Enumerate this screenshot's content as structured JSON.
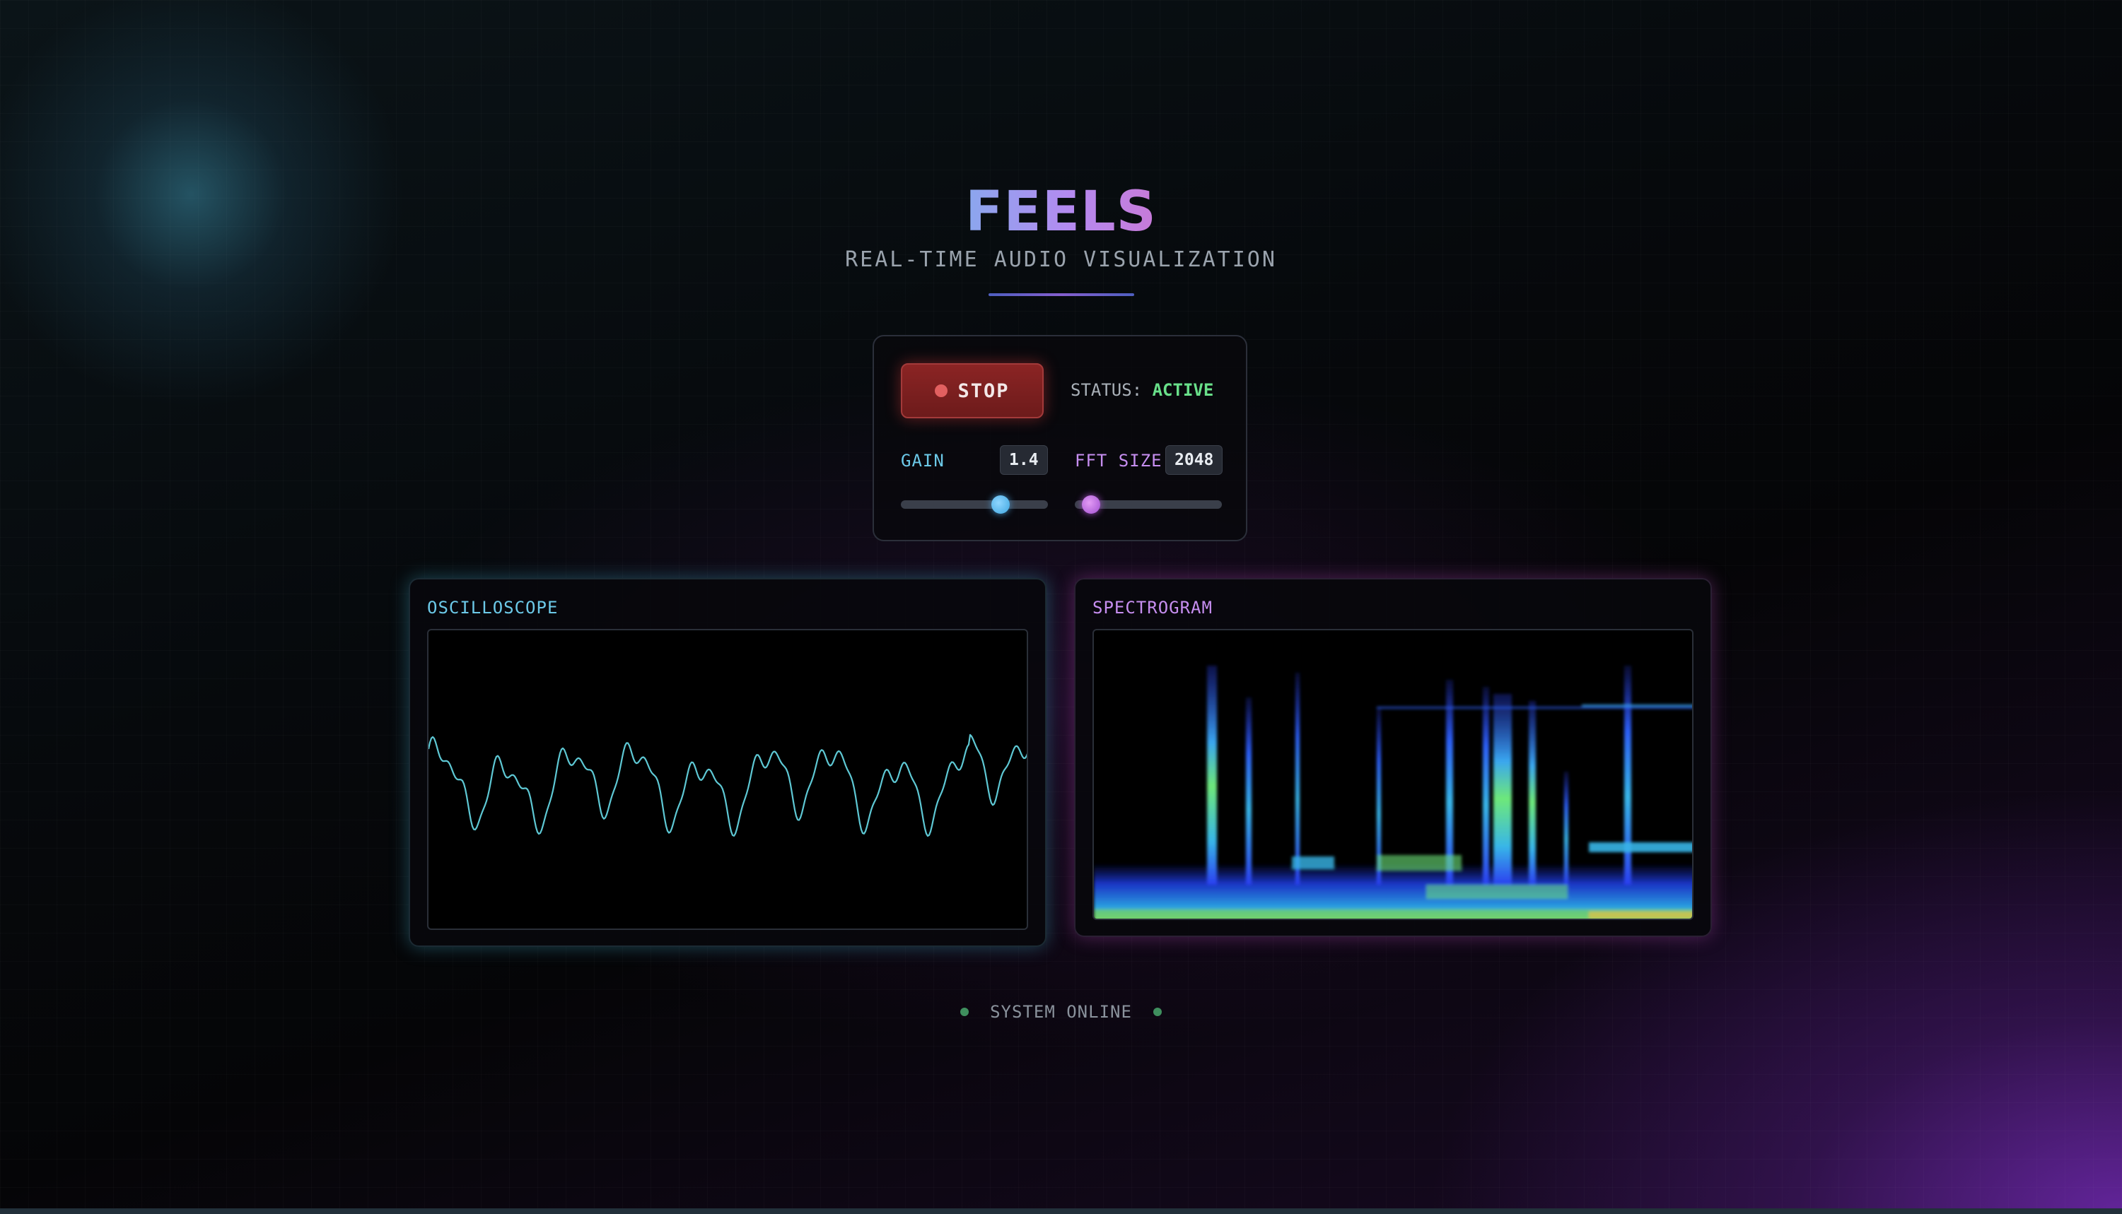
{
  "header": {
    "title": "FEELS",
    "subtitle": "REAL-TIME AUDIO VISUALIZATION"
  },
  "controls": {
    "stop_label": "STOP",
    "status_label": "STATUS:",
    "status_value": "ACTIVE",
    "gain_label": "GAIN",
    "gain_value": "1.4",
    "gain_fraction": 0.68,
    "fft_label": "FFT SIZE",
    "fft_value": "2048",
    "fft_fraction": 0.11
  },
  "panels": {
    "oscilloscope_label": "OSCILLOSCOPE",
    "spectrogram_label": "SPECTROGRAM"
  },
  "footer": {
    "status_text": "SYSTEM ONLINE"
  },
  "colors": {
    "accent_cyan": "#6cc9e8",
    "accent_purple": "#c68ef0",
    "status_active": "#69e08a",
    "stop_red": "#8b2424"
  }
}
